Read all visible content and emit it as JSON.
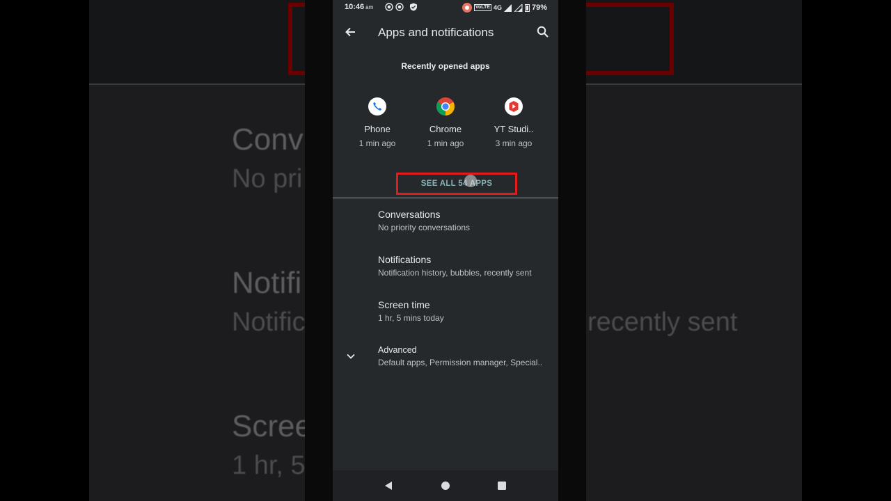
{
  "status_bar": {
    "time": "10:46",
    "ampm": "am",
    "network": "4G",
    "volte": "VoLTE",
    "battery": "79%",
    "icons": [
      "screen-record-icon",
      "screen-record-icon",
      "shield-check-icon",
      "recording-dot-icon",
      "signal-icon",
      "battery-icon"
    ]
  },
  "app_bar": {
    "title": "Apps and notifications",
    "back_icon": "arrow-left-icon",
    "search_icon": "search-icon"
  },
  "recent": {
    "label": "Recently opened apps",
    "apps": [
      {
        "name": "Phone",
        "time": "1 min ago",
        "icon": "phone-icon",
        "color": "#1a73e8"
      },
      {
        "name": "Chrome",
        "time": "1 min ago",
        "icon": "chrome-icon",
        "color": "#4285f4"
      },
      {
        "name": "YT Studi..",
        "time": "3 min ago",
        "icon": "yt-studio-icon",
        "color": "#e53935"
      }
    ],
    "see_all": "SEE ALL 54 APPS"
  },
  "preferences": [
    {
      "title": "Conversations",
      "summary": "No priority conversations"
    },
    {
      "title": "Notifications",
      "summary": "Notification history, bubbles, recently sent"
    },
    {
      "title": "Screen time",
      "summary": "1 hr, 5 mins today"
    },
    {
      "title": "Advanced",
      "summary": "Default apps, Permission manager, Special..",
      "icon": "chevron-down-icon"
    }
  ],
  "background_echo": {
    "line1": "Conv",
    "line2": "No pri",
    "line3": "Notifi",
    "line4": "Notific",
    "line5": "recently sent",
    "line6": "Scree",
    "line7": "1 hr, 5"
  },
  "nav_bar": {
    "icons": [
      "back-triangle-icon",
      "home-circle-icon",
      "recents-square-icon"
    ]
  },
  "colors": {
    "accent": "#8ab4b8",
    "highlight_box": "#e21b1b",
    "screen_bg": "#25292b"
  }
}
